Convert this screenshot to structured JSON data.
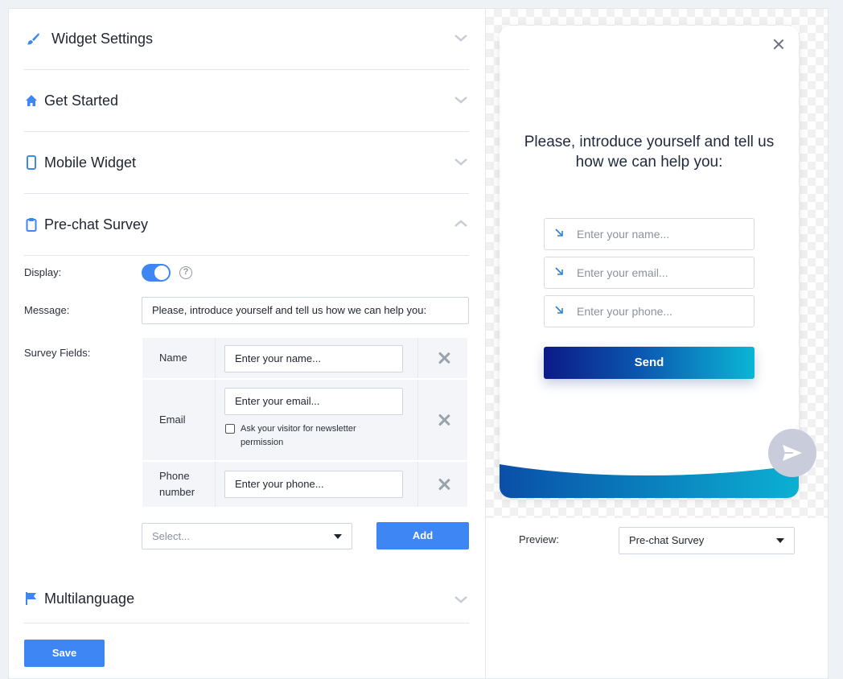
{
  "sections": {
    "widget_settings": "Widget Settings",
    "get_started": "Get Started",
    "mobile_widget": "Mobile Widget",
    "pre_chat_survey": "Pre-chat Survey",
    "multilanguage": "Multilanguage"
  },
  "survey": {
    "display_label": "Display:",
    "display_enabled": true,
    "help_glyph": "?",
    "message_label": "Message:",
    "message_value": "Please, introduce yourself and tell us how we can help you:",
    "fields_label": "Survey Fields:",
    "fields": [
      {
        "label": "Name",
        "placeholder": "Enter your name..."
      },
      {
        "label": "Email",
        "placeholder": "Enter your email...",
        "newsletter": "Ask your visitor for newsletter permission"
      },
      {
        "label": "Phone number",
        "placeholder": "Enter your phone..."
      }
    ],
    "select_placeholder": "Select...",
    "add_label": "Add"
  },
  "save_label": "Save",
  "preview": {
    "heading": "Please, introduce yourself and tell us how we can help you:",
    "name_placeholder": "Enter your name...",
    "email_placeholder": "Enter your email...",
    "phone_placeholder": "Enter your phone...",
    "send_label": "Send",
    "preview_label": "Preview:",
    "preview_value": "Pre-chat Survey"
  },
  "colors": {
    "accent": "#3f86f5",
    "send_gradient_start": "#0c1a87",
    "send_gradient_end": "#0bb6d4"
  },
  "icons": [
    "brush-icon",
    "home-icon",
    "mobile-icon",
    "clipboard-icon",
    "flag-icon",
    "chevron-down-icon",
    "chevron-up-icon",
    "close-icon",
    "arrow-icon",
    "send-icon",
    "help-icon"
  ]
}
